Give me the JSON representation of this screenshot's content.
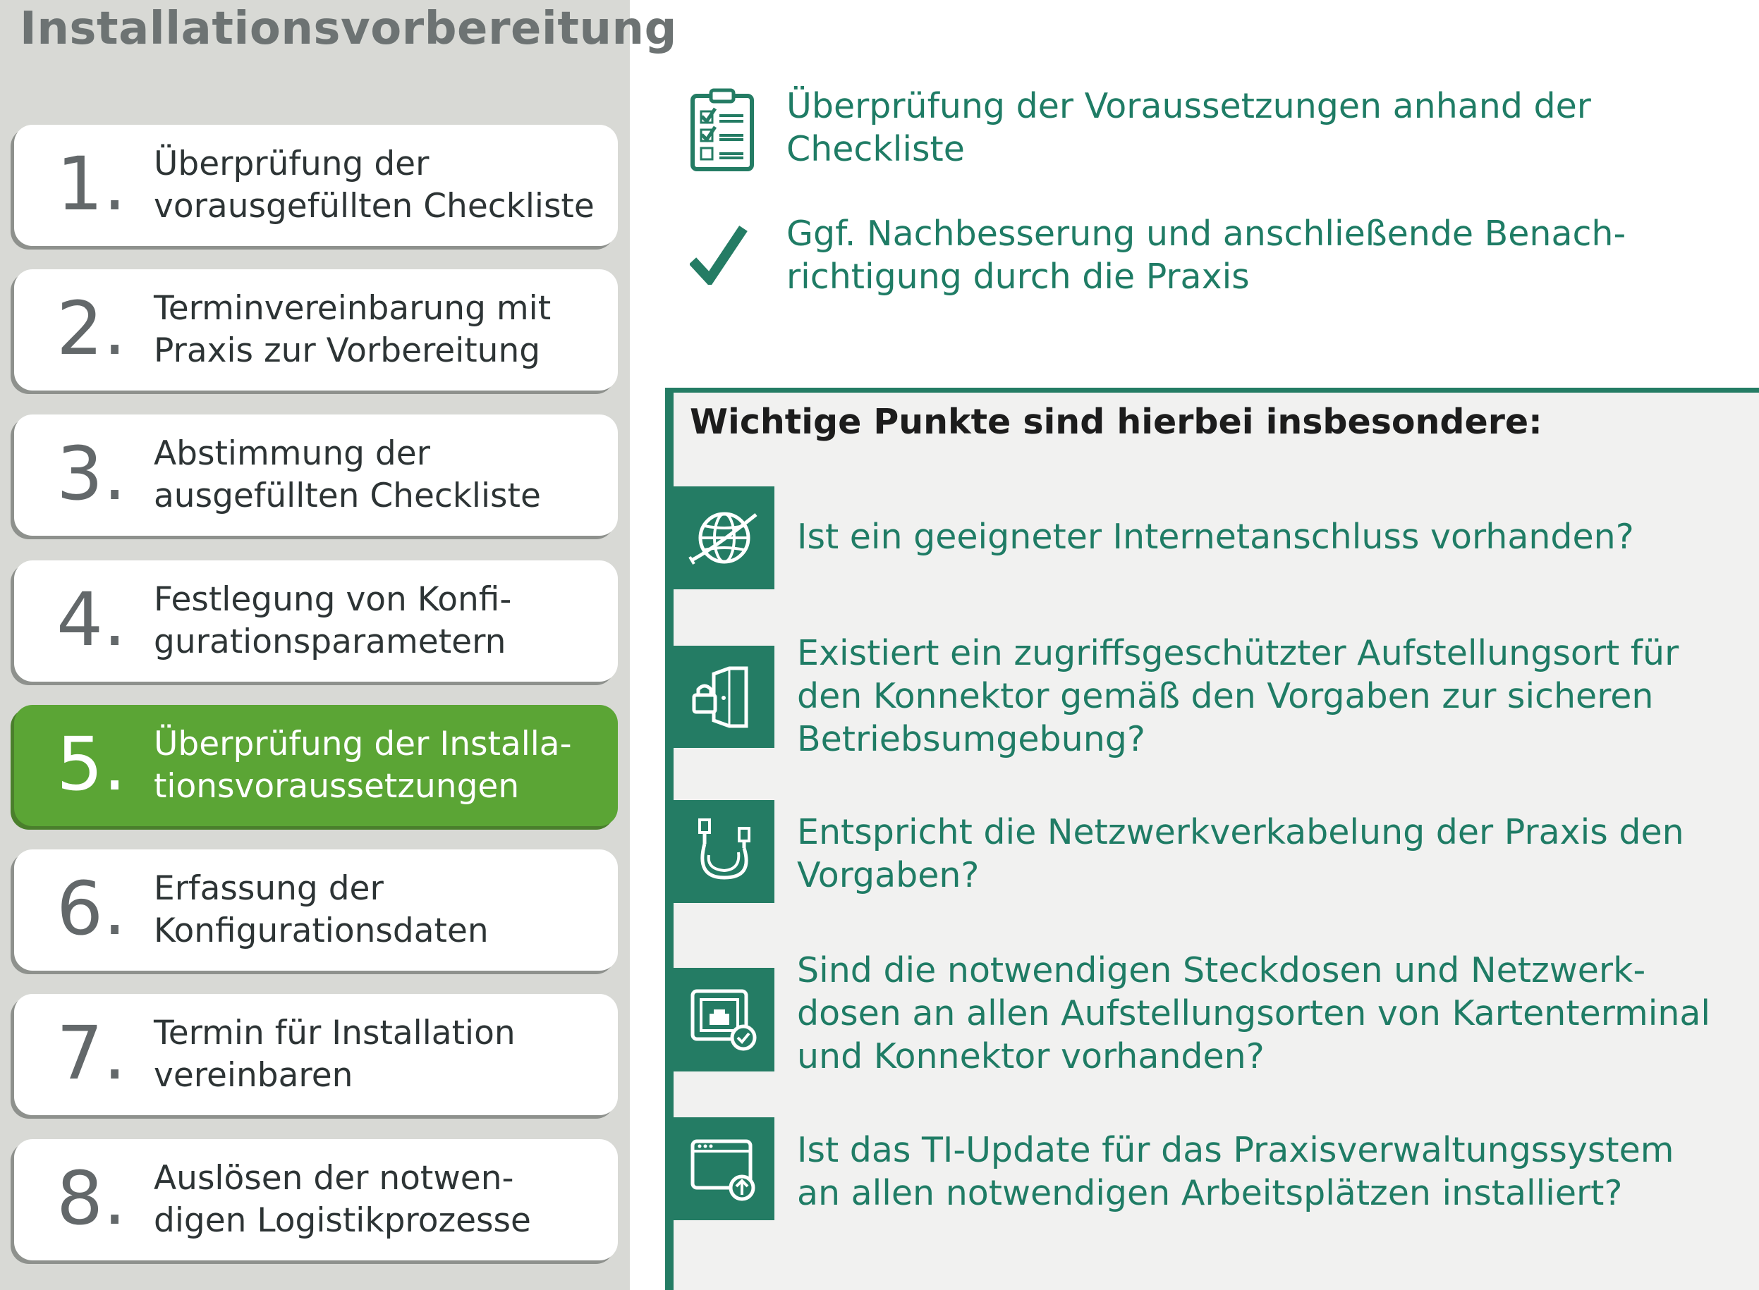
{
  "sidebar": {
    "title": "Installationsvorbereitung",
    "steps": [
      {
        "num": "1.",
        "text": "Überprüfung der\nvorausgefüllten Checkliste",
        "active": false
      },
      {
        "num": "2.",
        "text": "Terminvereinbarung mit\nPraxis zur Vorbereitung",
        "active": false
      },
      {
        "num": "3.",
        "text": "Abstimmung der\nausgefüllten Checkliste",
        "active": false
      },
      {
        "num": "4.",
        "text": "Festlegung von Konfi-\ngurationsparametern",
        "active": false
      },
      {
        "num": "5.",
        "text": "Überprüfung der Installa-\ntionsvoraussetzungen",
        "active": true
      },
      {
        "num": "6.",
        "text": "Erfassung der\nKonfigurationsdaten",
        "active": false
      },
      {
        "num": "7.",
        "text": "Termin für Installation\nvereinbaren",
        "active": false
      },
      {
        "num": "8.",
        "text": "Auslösen der notwen-\ndigen Logistikprozesse",
        "active": false
      }
    ]
  },
  "top_items": [
    {
      "icon": "clipboard-checklist-icon",
      "text": "Überprüfung der Voraussetzungen anhand der\nCheckliste"
    },
    {
      "icon": "checkmark-icon",
      "text": "Ggf. Nachbesserung und anschließende Benach-\nrichtigung durch die Praxis"
    }
  ],
  "panel": {
    "title": "Wichtige Punkte sind hierbei insbesondere:",
    "items": [
      {
        "icon": "globe-icon",
        "text": "Ist ein geeigneter Internetanschluss vorhanden?"
      },
      {
        "icon": "locked-door-icon",
        "text": "Existiert ein zugriffsgeschützter Aufstellungsort für\nden Konnektor gemäß den Vorgaben zur sicheren\nBetriebsumgebung?"
      },
      {
        "icon": "network-cable-icon",
        "text": "Entspricht die Netzwerkverkabelung der Praxis den\nVorgaben?"
      },
      {
        "icon": "network-socket-check-icon",
        "text": "Sind die notwendigen Steckdosen und Netzwerk-\ndosen an allen Aufstellungsorten von Kartenterminal\nund Konnektor vorhanden?"
      },
      {
        "icon": "software-update-icon",
        "text": "Ist das TI-Update für das Praxisverwaltungssystem\nan allen notwendigen Arbeitsplätzen installiert?"
      }
    ]
  },
  "colors": {
    "sidebar_bg": "#d8d9d5",
    "active_step": "#5ba535",
    "accent_teal": "#247c64",
    "teal_text": "#1f7c65",
    "panel_bg": "#f1f1f0"
  }
}
